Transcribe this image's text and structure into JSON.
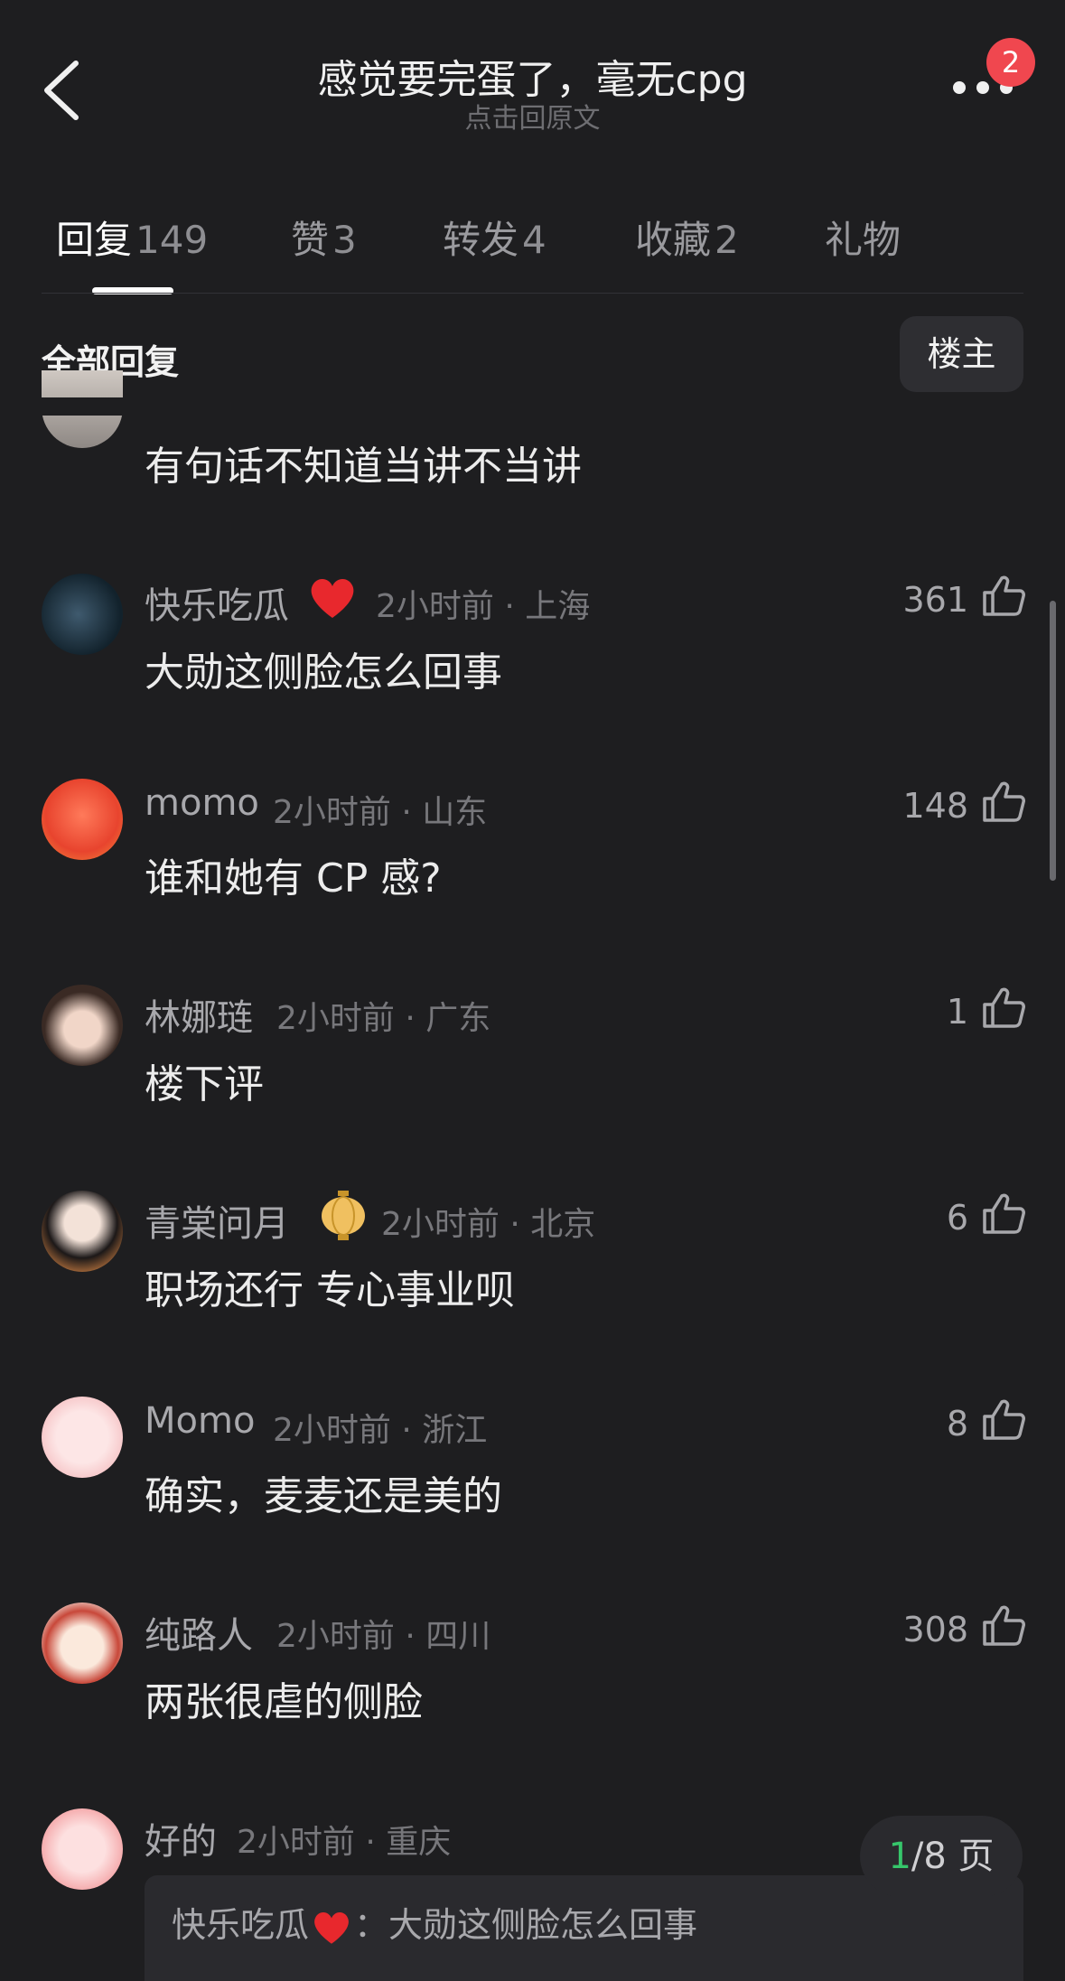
{
  "header": {
    "title": "感觉要完蛋了，毫无cpg",
    "subtitle": "点击回原文",
    "badge_count": "2"
  },
  "tabs": [
    {
      "label": "回复",
      "count": "149",
      "active": true
    },
    {
      "label": "赞",
      "count": "3"
    },
    {
      "label": "转发",
      "count": "4"
    },
    {
      "label": "收藏",
      "count": "2"
    },
    {
      "label": "礼物",
      "count": ""
    }
  ],
  "filter": {
    "all_label": "全部回复",
    "op_label": "楼主"
  },
  "partial_comment": {
    "text": "有句话不知道当讲不当讲"
  },
  "comments": [
    {
      "user": "快乐吃瓜",
      "meta": "2小时前 · 上海",
      "likes": "361",
      "text": "大勋这侧脸怎么回事"
    },
    {
      "user": "momo",
      "meta": "2小时前 · 山东",
      "likes": "148",
      "text": "谁和她有 CP 感?"
    },
    {
      "user": "林娜琏",
      "meta": "2小时前 · 广东",
      "likes": "1",
      "text": "楼下评"
    },
    {
      "user": "青棠问月",
      "meta": "2小时前 · 北京",
      "likes": "6",
      "text": "职场还行 专心事业呗"
    },
    {
      "user": "Momo",
      "meta": "2小时前 · 浙江",
      "likes": "8",
      "text": "确实，麦麦还是美的"
    },
    {
      "user": "纯路人",
      "meta": "2小时前 · 四川",
      "likes": "308",
      "text": "两张很虐的侧脸"
    },
    {
      "user": "好的",
      "meta": "2小时前 · 重庆",
      "likes": "",
      "text": ""
    }
  ],
  "quote": {
    "user": "快乐吃瓜",
    "separator": "：",
    "text": "大勋这侧脸怎么回事"
  },
  "pager": {
    "current": "1",
    "total": "/8 页"
  },
  "colors": {
    "background": "#1e1e20",
    "badge": "#f0474f",
    "pager_current": "#36c66b"
  }
}
